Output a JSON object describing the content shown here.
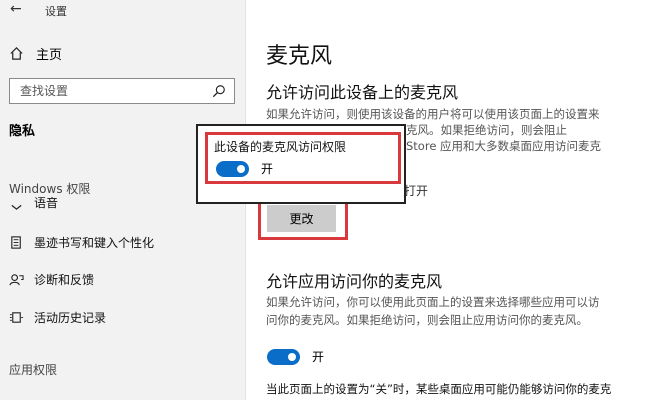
{
  "app": {
    "title": "设置"
  },
  "sidebar": {
    "home": "主页",
    "search_placeholder": "查找设置",
    "current": "隐私",
    "windows_permissions": "Windows 权限",
    "items": [
      {
        "label": "语音",
        "icon": "speech-icon"
      },
      {
        "label": "墨迹书写和键入个性化",
        "icon": "inking-icon"
      },
      {
        "label": "诊断和反馈",
        "icon": "feedback-icon"
      },
      {
        "label": "活动历史记录",
        "icon": "history-icon"
      }
    ],
    "app_permissions": "应用权限"
  },
  "main": {
    "title": "麦克风",
    "section1": {
      "heading": "允许访问此设备上的麦克风",
      "desc_line1": "如果允许访问，则使用该设备的用户将可以使用该页面上的设置来",
      "desc_line2": "克风。如果拒绝访问，则会阻止",
      "desc_line3": "Store 应用和大多数桌面应用访问麦克",
      "status_suffix": "打开",
      "change_button": "更改"
    },
    "section2": {
      "heading": "允许应用访问你的麦克风",
      "desc_line1": "如果允许访问，你可以使用此页面上的设置来选择哪些应用可以访",
      "desc_line2": "问你的麦克风。如果拒绝访问，则会阻止应用访问你的麦克风。",
      "toggle_label": "开"
    },
    "bottom_text": "当此页面上的设置为“关”时，某些桌面应用可能仍能够访问你的麦克"
  },
  "popup": {
    "title": "此设备的麦克风访问权限",
    "toggle_label": "开"
  },
  "colors": {
    "accent": "#0a6ec8",
    "highlight": "#d9383d"
  }
}
